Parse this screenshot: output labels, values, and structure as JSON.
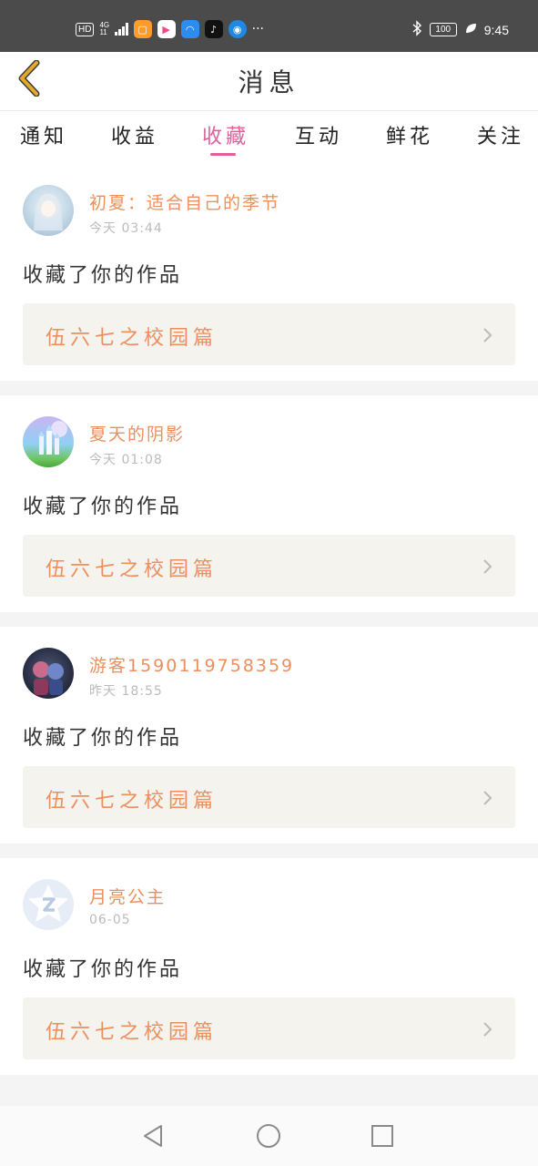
{
  "status_bar": {
    "hd_badge": "HD",
    "network_type": "4G",
    "network_sub": "11",
    "battery_level": "100",
    "time": "9:45",
    "more_indicator": "···",
    "app_icons": [
      "taobao-icon",
      "video-app-icon",
      "cloud-app-icon",
      "tiktok-icon",
      "browser-icon"
    ]
  },
  "header": {
    "title": "消息"
  },
  "tabs": [
    {
      "label": "通知",
      "active": false
    },
    {
      "label": "收益",
      "active": false
    },
    {
      "label": "收藏",
      "active": true
    },
    {
      "label": "互动",
      "active": false
    },
    {
      "label": "鲜花",
      "active": false
    },
    {
      "label": "关注",
      "active": false
    }
  ],
  "messages": [
    {
      "username": "初夏：适合自己的季节",
      "time": "今天 03:44",
      "action": "收藏了你的作品",
      "work_title": "伍六七之校园篇",
      "avatar": "anime-girl-avatar"
    },
    {
      "username": "夏天的阴影",
      "time": "今天 01:08",
      "action": "收藏了你的作品",
      "work_title": "伍六七之校园篇",
      "avatar": "castle-avatar"
    },
    {
      "username": "游客15901197583​59",
      "time": "昨天 18:55",
      "action": "收藏了你的作品",
      "work_title": "伍六七之校园篇",
      "avatar": "couple-avatar"
    },
    {
      "username": "月亮公主",
      "time": "06-05",
      "action": "收藏了你的作品",
      "work_title": "伍六七之校园篇",
      "avatar": "default-star-avatar"
    }
  ],
  "colors": {
    "accent_pink": "#e0609b",
    "accent_orange": "#ec8f5f",
    "back_arrow": "#e2a92b"
  }
}
